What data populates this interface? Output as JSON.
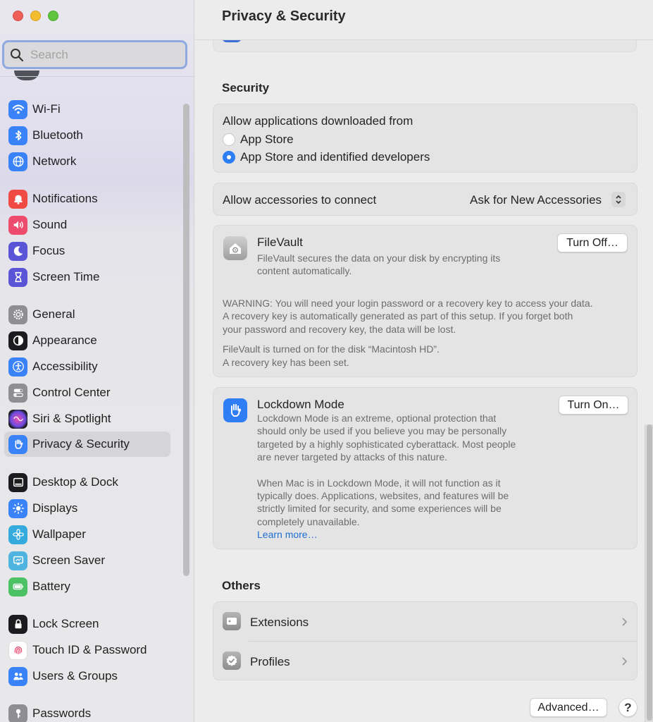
{
  "window": {
    "title": "Privacy & Security"
  },
  "search": {
    "placeholder": "Search",
    "icon": "magnifying-glass-icon"
  },
  "sidebar": {
    "items": [
      {
        "label": "Wi-Fi",
        "icon": "wifi-icon",
        "color": "#3a82f7"
      },
      {
        "label": "Bluetooth",
        "icon": "bluetooth-icon",
        "color": "#3a82f7"
      },
      {
        "label": "Network",
        "icon": "globe-icon",
        "color": "#3a82f7"
      },
      {
        "label": "Notifications",
        "icon": "bell-icon",
        "color": "#ef4b44"
      },
      {
        "label": "Sound",
        "icon": "speaker-icon",
        "color": "#ee4c6c"
      },
      {
        "label": "Focus",
        "icon": "moon-icon",
        "color": "#5a54d6"
      },
      {
        "label": "Screen Time",
        "icon": "hourglass-icon",
        "color": "#5a54d6"
      },
      {
        "label": "General",
        "icon": "gear-icon",
        "color": "#8e8e93"
      },
      {
        "label": "Appearance",
        "icon": "appearance-icon",
        "color": "#1c1c1e"
      },
      {
        "label": "Accessibility",
        "icon": "accessibility-icon",
        "color": "#3a82f7"
      },
      {
        "label": "Control Center",
        "icon": "toggles-icon",
        "color": "#8e8e93"
      },
      {
        "label": "Siri & Spotlight",
        "icon": "siri-icon",
        "color": "#1c1c1e"
      },
      {
        "label": "Privacy & Security",
        "icon": "hand-icon",
        "color": "#3a82f7"
      },
      {
        "label": "Desktop & Dock",
        "icon": "dock-icon",
        "color": "#1c1c1e"
      },
      {
        "label": "Displays",
        "icon": "sun-icon",
        "color": "#3a82f7"
      },
      {
        "label": "Wallpaper",
        "icon": "flower-icon",
        "color": "#35aadc"
      },
      {
        "label": "Screen Saver",
        "icon": "screensaver-icon",
        "color": "#4fb5e0"
      },
      {
        "label": "Battery",
        "icon": "battery-icon",
        "color": "#4cc264"
      },
      {
        "label": "Lock Screen",
        "icon": "lock-icon",
        "color": "#1c1c1e"
      },
      {
        "label": "Touch ID & Password",
        "icon": "fingerprint-icon",
        "color": "#ffffff"
      },
      {
        "label": "Users & Groups",
        "icon": "users-icon",
        "color": "#3a82f7"
      },
      {
        "label": "Passwords",
        "icon": "key-icon",
        "color": "#8e8e93"
      }
    ],
    "selected": "Privacy & Security"
  },
  "security": {
    "section_title": "Security",
    "allow_apps_label": "Allow applications downloaded from",
    "options": [
      {
        "label": "App Store",
        "selected": false
      },
      {
        "label": "App Store and identified developers",
        "selected": true
      }
    ],
    "accessories_label": "Allow accessories to connect",
    "accessories_value": "Ask for New Accessories"
  },
  "filevault": {
    "title": "FileVault",
    "description_line1": "FileVault secures the data on your disk by encrypting its",
    "description_line2": "content automatically.",
    "button": "Turn Off…",
    "warning_line1": "WARNING: You will need your login password or a recovery key to access your data.",
    "warning_line2": "A recovery key is automatically generated as part of this setup. If you forget both",
    "warning_line3": "your password and recovery key, the data will be lost.",
    "status_line1": "FileVault is turned on for the disk “Macintosh HD”.",
    "status_line2": "A recovery key has been set."
  },
  "lockdown": {
    "title": "Lockdown Mode",
    "button": "Turn On…",
    "p1_line1": "Lockdown Mode is an extreme, optional protection that",
    "p1_line2": "should only be used if you believe you may be personally",
    "p1_line3": "targeted by a highly sophisticated cyberattack. Most people",
    "p1_line4": "are never targeted by attacks of this nature.",
    "p2_line1": "When Mac is in Lockdown Mode, it will not function as it",
    "p2_line2": "typically does. Applications, websites, and features will be",
    "p2_line3": "strictly limited for security, and some experiences will be",
    "p2_line4": "completely unavailable.",
    "learn_more": "Learn more…"
  },
  "others": {
    "section_title": "Others",
    "items": [
      {
        "label": "Extensions",
        "icon": "extensions-icon"
      },
      {
        "label": "Profiles",
        "icon": "profiles-checkmark-icon"
      }
    ]
  },
  "footer": {
    "advanced_button": "Advanced…",
    "help_button": "?"
  }
}
